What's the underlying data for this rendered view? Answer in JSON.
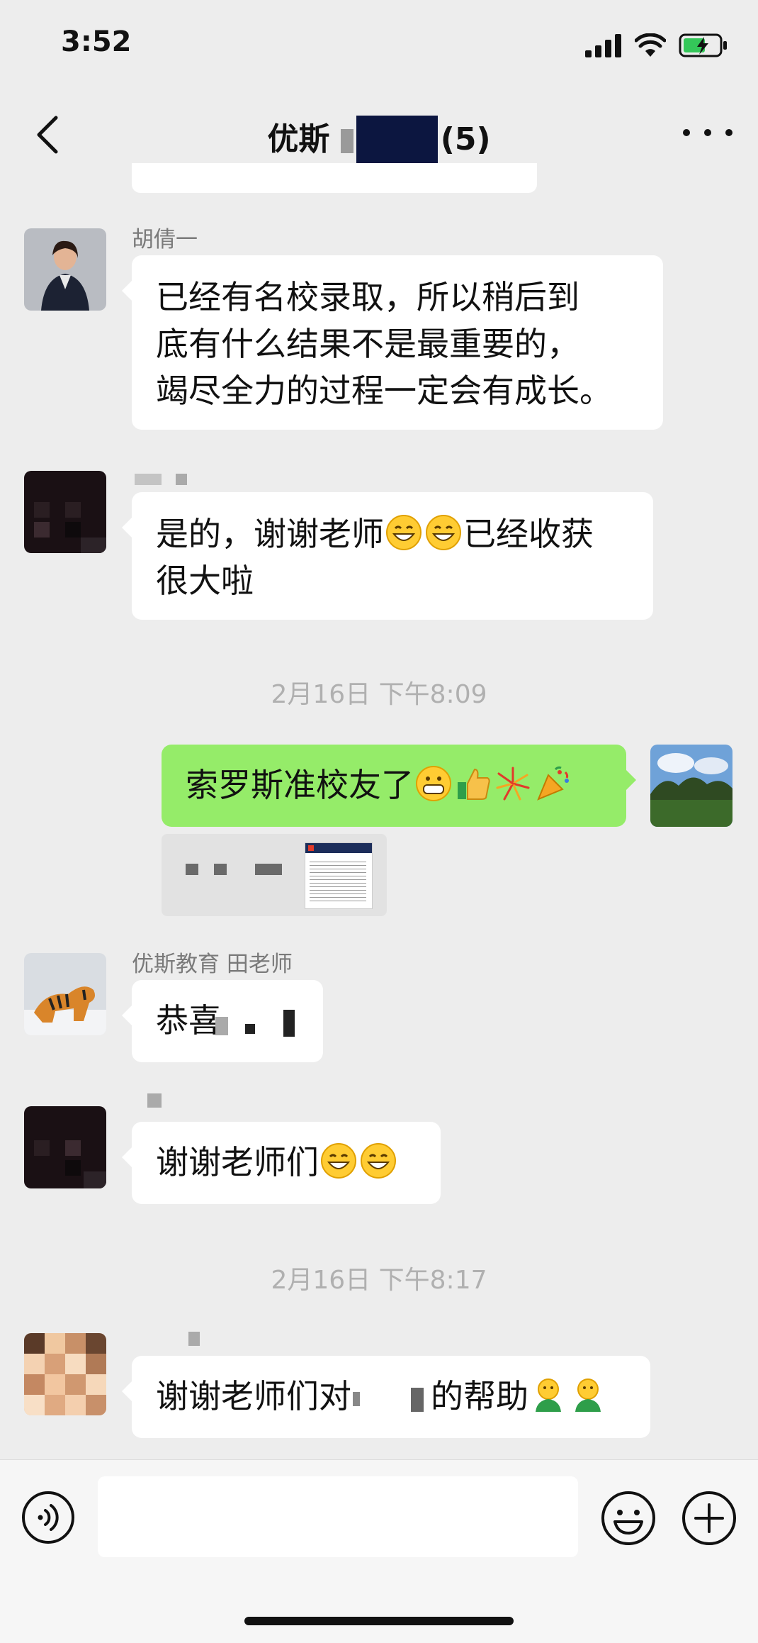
{
  "status_bar": {
    "time": "3:52"
  },
  "header": {
    "title_prefix": "优斯",
    "title_count": "(5)"
  },
  "messages": [
    {
      "sender": "胡倩一",
      "lines": [
        "已经有名校录取，所以稍后到",
        "底有什么结果不是最重要的，",
        "竭尽全力的过程一定会有成长。"
      ]
    },
    {
      "sender": "",
      "line1_text": "是的，谢谢老师",
      "line1_suffix": "已经收获",
      "line2": "很大啦"
    },
    {
      "sender": "",
      "text": "索罗斯准校友了"
    },
    {
      "sender": "优斯教育 田老师",
      "text": "恭喜"
    },
    {
      "sender": "",
      "text": "谢谢老师们"
    },
    {
      "sender": "",
      "text_before": "谢谢老师们对",
      "text_after": "的帮助"
    }
  ],
  "time_separators": [
    "2月16日 下午8:09",
    "2月16日 下午8:17"
  ],
  "icons": {
    "back": "chevron-left-icon",
    "more": "more-dots-icon",
    "voice": "voice-icon",
    "emoji": "smiley-icon",
    "plus": "plus-icon"
  },
  "colors": {
    "mine_bubble": "#95ec69",
    "background": "#ededed",
    "title_redaction": "#0c1640"
  }
}
